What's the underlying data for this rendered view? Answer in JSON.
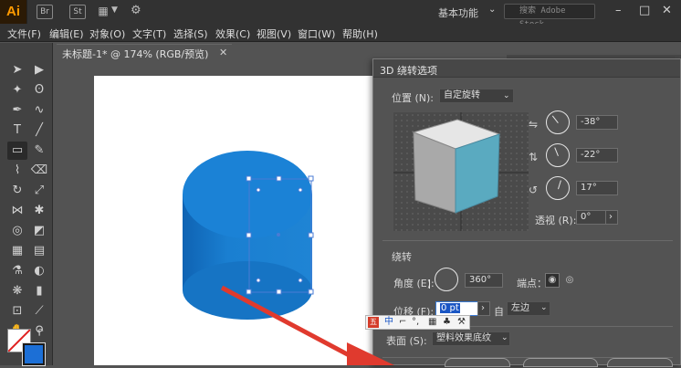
{
  "app": {
    "logo": "Ai",
    "icons": [
      "Br",
      "St"
    ],
    "workspace": "基本功能",
    "stock_search_placeholder": "搜索 Adobe Stock"
  },
  "menu": [
    "文件(F)",
    "编辑(E)",
    "对象(O)",
    "文字(T)",
    "选择(S)",
    "效果(C)",
    "视图(V)",
    "窗口(W)",
    "帮助(H)"
  ],
  "document": {
    "tab_title": "未标题-1* @ 174% (RGB/预览)"
  },
  "dialog": {
    "title": "3D 绕转选项",
    "position_label": "位置 (N):",
    "position_value": "自定旋转",
    "rot_x": "-38°",
    "rot_y": "-22°",
    "rot_z": "17°",
    "perspective_label": "透视 (R):",
    "perspective_value": "0°",
    "revolve_section": "绕转",
    "angle_label": "角度 (E):",
    "angle_value": "360°",
    "cap_label": "端点：",
    "offset_label": "位移 (F):",
    "offset_value": "0 pt",
    "from_label": "自",
    "from_value": "左边",
    "surface_label": "表面 (S):",
    "surface_value": "塑料效果底纹"
  },
  "ime": {
    "segments": [
      "中",
      "⌐",
      "°,",
      "▦",
      "♣",
      "⚒"
    ]
  },
  "colors": {
    "cylinder": "#1a7fd1",
    "cylinder_dark": "#0e5fa8",
    "arrow": "#e03a2e",
    "cube_top": "#e6e6e6",
    "cube_left": "#a9a9a9",
    "cube_right": "#5aaac0"
  }
}
